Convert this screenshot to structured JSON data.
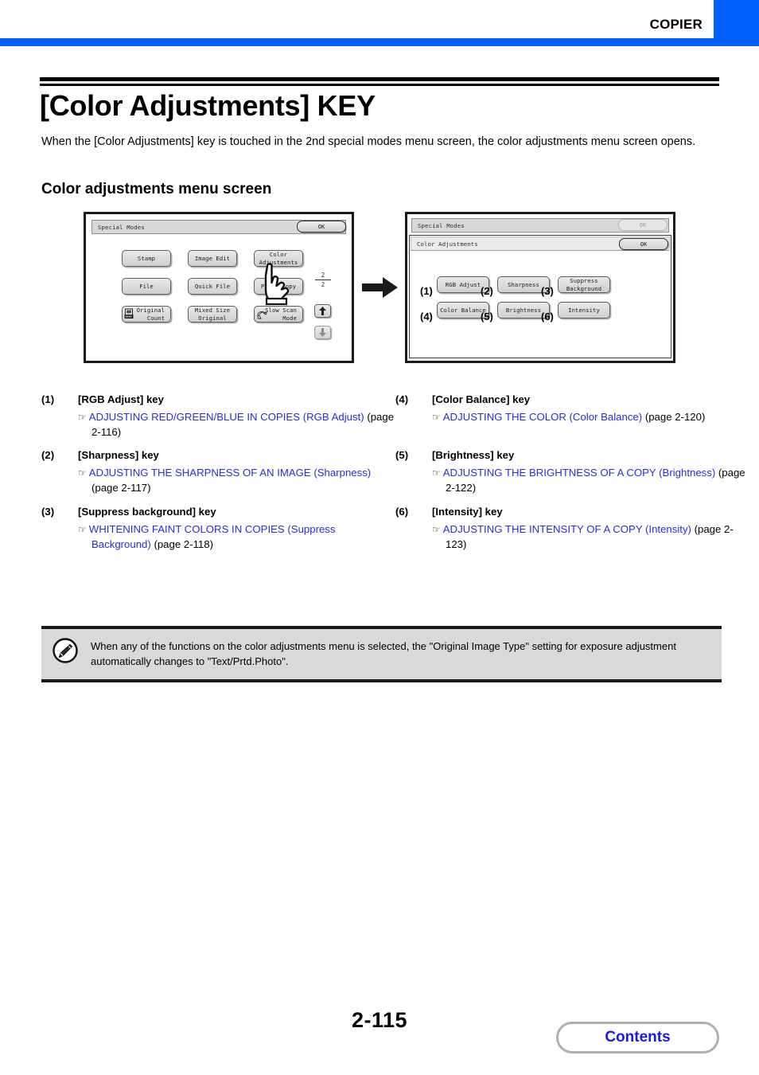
{
  "header": {
    "section_label": "COPIER",
    "accent_color": "#0061fe"
  },
  "title": "[Color Adjustments] KEY",
  "intro": "When the [Color Adjustments] key is touched in the 2nd special modes menu screen, the color adjustments menu screen opens.",
  "subheading": "Color adjustments menu screen",
  "figure_left": {
    "titlebar": "Special Modes",
    "ok_label": "OK",
    "keys": [
      "Stamp",
      "Image Edit",
      "Color\nAdjustments",
      "File",
      "Quick File",
      "Proof Copy",
      "Original\nCount",
      "Mixed Size\nOriginal",
      "Slow Scan\nMode"
    ],
    "key_stamp": "Stamp",
    "key_image_edit": "Image Edit",
    "key_color_adjustments_l1": "Color",
    "key_color_adjustments_l2": "Adjustments",
    "key_file": "File",
    "key_quick_file": "Quick File",
    "key_proof_copy": "Proof Copy",
    "key_original_count_l1": "Original",
    "key_original_count_l2": "Count",
    "key_mixed_size_l1": "Mixed Size",
    "key_mixed_size_l2": "Original",
    "key_slow_scan_l1": "Slow Scan",
    "key_slow_scan_l2": "Mode",
    "page_current": "2",
    "page_total": "2"
  },
  "figure_right": {
    "titlebar_back": "Special Modes",
    "ok_label_back": "OK",
    "titlebar_front": "Color Adjustments",
    "ok_label_front": "OK",
    "key_rgb_adjust": "RGB Adjust",
    "key_sharpness": "Sharpness",
    "key_suppress_l1": "Suppress",
    "key_suppress_l2": "Background",
    "key_color_balance": "Color Balance",
    "key_brightness": "Brightness",
    "key_intensity": "Intensity",
    "callouts": [
      "(1)",
      "(2)",
      "(3)",
      "(4)",
      "(5)",
      "(6)"
    ]
  },
  "references": [
    {
      "index": "(1)",
      "key_name": "[RGB Adjust] key",
      "link_text": "ADJUSTING RED/GREEN/BLUE IN COPIES (RGB Adjust)",
      "page_ref": "(page 2-116)"
    },
    {
      "index": "(2)",
      "key_name": "[Sharpness] key",
      "link_text": "ADJUSTING THE SHARPNESS OF AN IMAGE (Sharpness)",
      "page_ref": "(page 2-117)"
    },
    {
      "index": "(3)",
      "key_name": "[Suppress background] key",
      "link_text": "WHITENING FAINT COLORS IN COPIES (Suppress Background)",
      "page_ref": "(page 2-118)"
    },
    {
      "index": "(4)",
      "key_name": "[Color Balance] key",
      "link_text": "ADJUSTING THE COLOR (Color Balance)",
      "page_ref": "(page 2-120)"
    },
    {
      "index": "(5)",
      "key_name": "[Brightness] key",
      "link_text": "ADJUSTING THE BRIGHTNESS OF A COPY (Brightness)",
      "page_ref": "(page 2-122)"
    },
    {
      "index": "(6)",
      "key_name": "[Intensity] key",
      "link_text": "ADJUSTING THE INTENSITY OF A COPY (Intensity)",
      "page_ref": "(page 2-123)"
    }
  ],
  "note": {
    "text": "When any of the functions on the color adjustments menu is selected, the \"Original Image Type\" setting for exposure adjustment automatically changes to \"Text/Prtd.Photo\".",
    "icon": "pencil-note-icon"
  },
  "footer": {
    "page_number": "2-115",
    "contents_label": "Contents",
    "link_color": "#1a1ae6"
  }
}
